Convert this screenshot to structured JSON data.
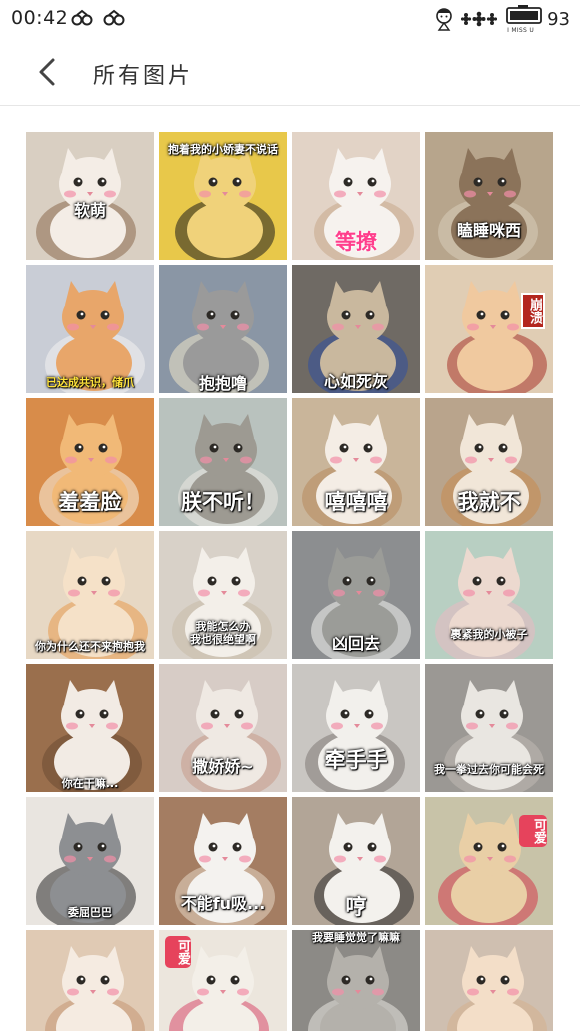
{
  "status_bar": {
    "time": "00:42",
    "battery_label": "I MISS U",
    "battery_level": "93"
  },
  "header": {
    "title": "所有图片"
  },
  "tiles": [
    {
      "caption": "软萌",
      "bg": "#d9cfc2",
      "cat": "#f4ede6",
      "acc": "#8a6a4f"
    },
    {
      "caption": "抱着我的小娇妻不说话",
      "bg": "#e8c84a",
      "cat": "#f0d27a",
      "acc": "#1d1d1d"
    },
    {
      "caption": "等撩",
      "bg": "#e2d3c6",
      "cat": "#f6f2ee",
      "acc": "#c7a88a"
    },
    {
      "caption": "瞌睡咪西",
      "bg": "#b7a58c",
      "cat": "#8b735a",
      "acc": "#d9cdb9"
    },
    {
      "caption": "已达成共识，储爪",
      "bg": "#c9cdd6",
      "cat": "#e8a66a",
      "acc": "#f3f3f3"
    },
    {
      "caption": "抱抱噜",
      "bg": "#8a96a5",
      "cat": "#9a9a9a",
      "acc": "#efe6c9"
    },
    {
      "caption": "心如死灰",
      "bg": "#6f6a64",
      "cat": "#c9b89e",
      "acc": "#2f4ea0"
    },
    {
      "caption": "崩溃",
      "bg": "#e0cdb4",
      "cat": "#f0c99f",
      "acc": "#a8342a"
    },
    {
      "caption": "羞羞脸",
      "bg": "#d88c4a",
      "cat": "#f1b977",
      "acc": "#faf0e0"
    },
    {
      "caption": "朕不听！",
      "bg": "#b9c2be",
      "cat": "#9d9a92",
      "acc": "#ece9e1"
    },
    {
      "caption": "嘻嘻嘻",
      "bg": "#c9b59a",
      "cat": "#f4ede5",
      "acc": "#b7895d"
    },
    {
      "caption": "我就不",
      "bg": "#b9a48c",
      "cat": "#f1e6d8",
      "acc": "#c98b4f"
    },
    {
      "caption": "你为什么还不来抱抱我",
      "bg": "#e7d8c4",
      "cat": "#f5e1c8",
      "acc": "#e79b4e"
    },
    {
      "caption": "我能怎么办\n我也很绝望啊",
      "bg": "#d8d1c8",
      "cat": "#f3efe9",
      "acc": "#c9bba8"
    },
    {
      "caption": "凶回去",
      "bg": "#8c8e90",
      "cat": "#9b9c98",
      "acc": "#f4f4f0"
    },
    {
      "caption": "裹紧我的小被子",
      "bg": "#b8cfc2",
      "cat": "#ecd9cf",
      "acc": "#e9b9c2"
    },
    {
      "caption": "你在干嘛...",
      "bg": "#9a6f4d",
      "cat": "#f2ebe4",
      "acc": "#6b4a33"
    },
    {
      "caption": "撒娇娇~",
      "bg": "#d7ccc6",
      "cat": "#efe9e3",
      "acc": "#c79a8a"
    },
    {
      "caption": "牵手手",
      "bg": "#c9c6c2",
      "cat": "#f2f0ec",
      "acc": "#7f7a76"
    },
    {
      "caption": "我一拳过去你可能会死",
      "bg": "#9b9894",
      "cat": "#e9e6e1",
      "acc": "#bfbab3"
    },
    {
      "caption": "委屈巴巴",
      "bg": "#e9e5e0",
      "cat": "#8d8f92",
      "acc": "#2a2a2a"
    },
    {
      "caption": "不能fu吸...",
      "bg": "#a47d62",
      "cat": "#f4f2ef",
      "acc": "#e5d7c5"
    },
    {
      "caption": "哼",
      "bg": "#b2a597",
      "cat": "#f3f1ed",
      "acc": "#2b2b2b"
    },
    {
      "caption": "可爱",
      "bg": "#c8c3a8",
      "cat": "#e9cfa6",
      "acc": "#d33a4a"
    },
    {
      "caption": "",
      "bg": "#e0cab4",
      "cat": "#f5ebe1",
      "acc": "#c49572"
    },
    {
      "caption": "可爱",
      "bg": "#ece6dd",
      "cat": "#f3efe8",
      "acc": "#d84b6b"
    },
    {
      "caption": "我要睡觉觉了嘛嘛",
      "bg": "#8c8a86",
      "cat": "#b4b1ab",
      "acc": "#e9e7e2"
    },
    {
      "caption": "",
      "bg": "#cfbfb0",
      "cat": "#f3dec8",
      "acc": "#d6b08e"
    }
  ]
}
